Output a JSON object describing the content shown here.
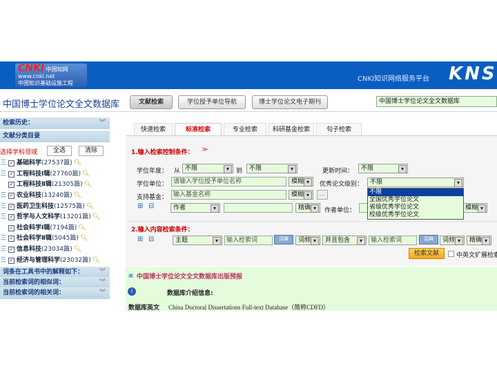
{
  "header": {
    "logo_text": "CNKI 中国知网 www.cnki.net 中国知识基础设施工程",
    "platform": "CNKI知识网络服务平台",
    "brand": "KNS"
  },
  "title": "中国博士学位论文全文数据库",
  "top_buttons": [
    "文献检索",
    "学位授予单位导航",
    "博士学位论文电子期刊"
  ],
  "db_select": "中国博士学位论文全文数据库",
  "sidebar": {
    "history": "检索历史：",
    "catalog": "文献分类目录",
    "select_label": "选择学科领域",
    "select_all": "全选",
    "clear": "清除",
    "categories": [
      {
        "name": "基础科学",
        "count": "(27537篇)"
      },
      {
        "name": "工程科技Ⅰ辑",
        "count": "(27760篇)"
      },
      {
        "name": "工程科技Ⅱ辑",
        "count": "(21305篇)"
      },
      {
        "name": "农业科技",
        "count": "(13240篇)"
      },
      {
        "name": "医药卫生科技",
        "count": "(12575篇)"
      },
      {
        "name": "哲学与人文科学",
        "count": "(13201篇)"
      },
      {
        "name": "社会科学Ⅰ辑",
        "count": "(7194篇)"
      },
      {
        "name": "社会科学Ⅱ辑",
        "count": "(5045篇)"
      },
      {
        "name": "信息科技",
        "count": "(23034篇)"
      },
      {
        "name": "经济与管理科学",
        "count": "(23032篇)"
      }
    ],
    "bottom": [
      "词条在工具书中的解释如下：",
      "当前检索词的相似词：",
      "当前检索词的相关词："
    ]
  },
  "tabs": [
    "快速检索",
    "标准检索",
    "专业检索",
    "科研基金检索",
    "句子检索"
  ],
  "form": {
    "sec1": "1.输入检索控制条件：",
    "year_label": "学位年度：",
    "from": "从",
    "year_from": "不限",
    "to": "到",
    "year_to": "不限",
    "update_label": "更新时间：",
    "update": "不限",
    "unit_label": "学位单位：",
    "unit_placeholder": "请输入学位授予单位名称",
    "unit_match": "模糊",
    "level_label": "优秀论文级别：",
    "level": "不限",
    "level_options": [
      "不限",
      "全国优秀学位论文",
      "省级优秀学位论文",
      "校级优秀学位论文"
    ],
    "fund_label": "支持基金：",
    "fund_placeholder": "输入基金名称",
    "fund_match": "模糊",
    "more": "…",
    "author_field": "作者",
    "author_match": "精确",
    "author_unit_label": "作者单位：",
    "author_unit_match": "模糊",
    "sec2": "2.输入内容检索条件：",
    "field": "主题",
    "kw_placeholder": "输入检索词",
    "freq": "词频",
    "logic": "并且包含",
    "freq2": "词频",
    "precision": "精确",
    "search_btn": "检索文献",
    "ext_label": "中英文扩展检索"
  },
  "info": {
    "notice": "中国博士学位论文全文数据库出版预报",
    "intro_label": "数据库介绍信息:",
    "en_label": "数据库英文",
    "en_name": "China Doctoral Dissertations Full-text Database（简称CDFD）"
  }
}
